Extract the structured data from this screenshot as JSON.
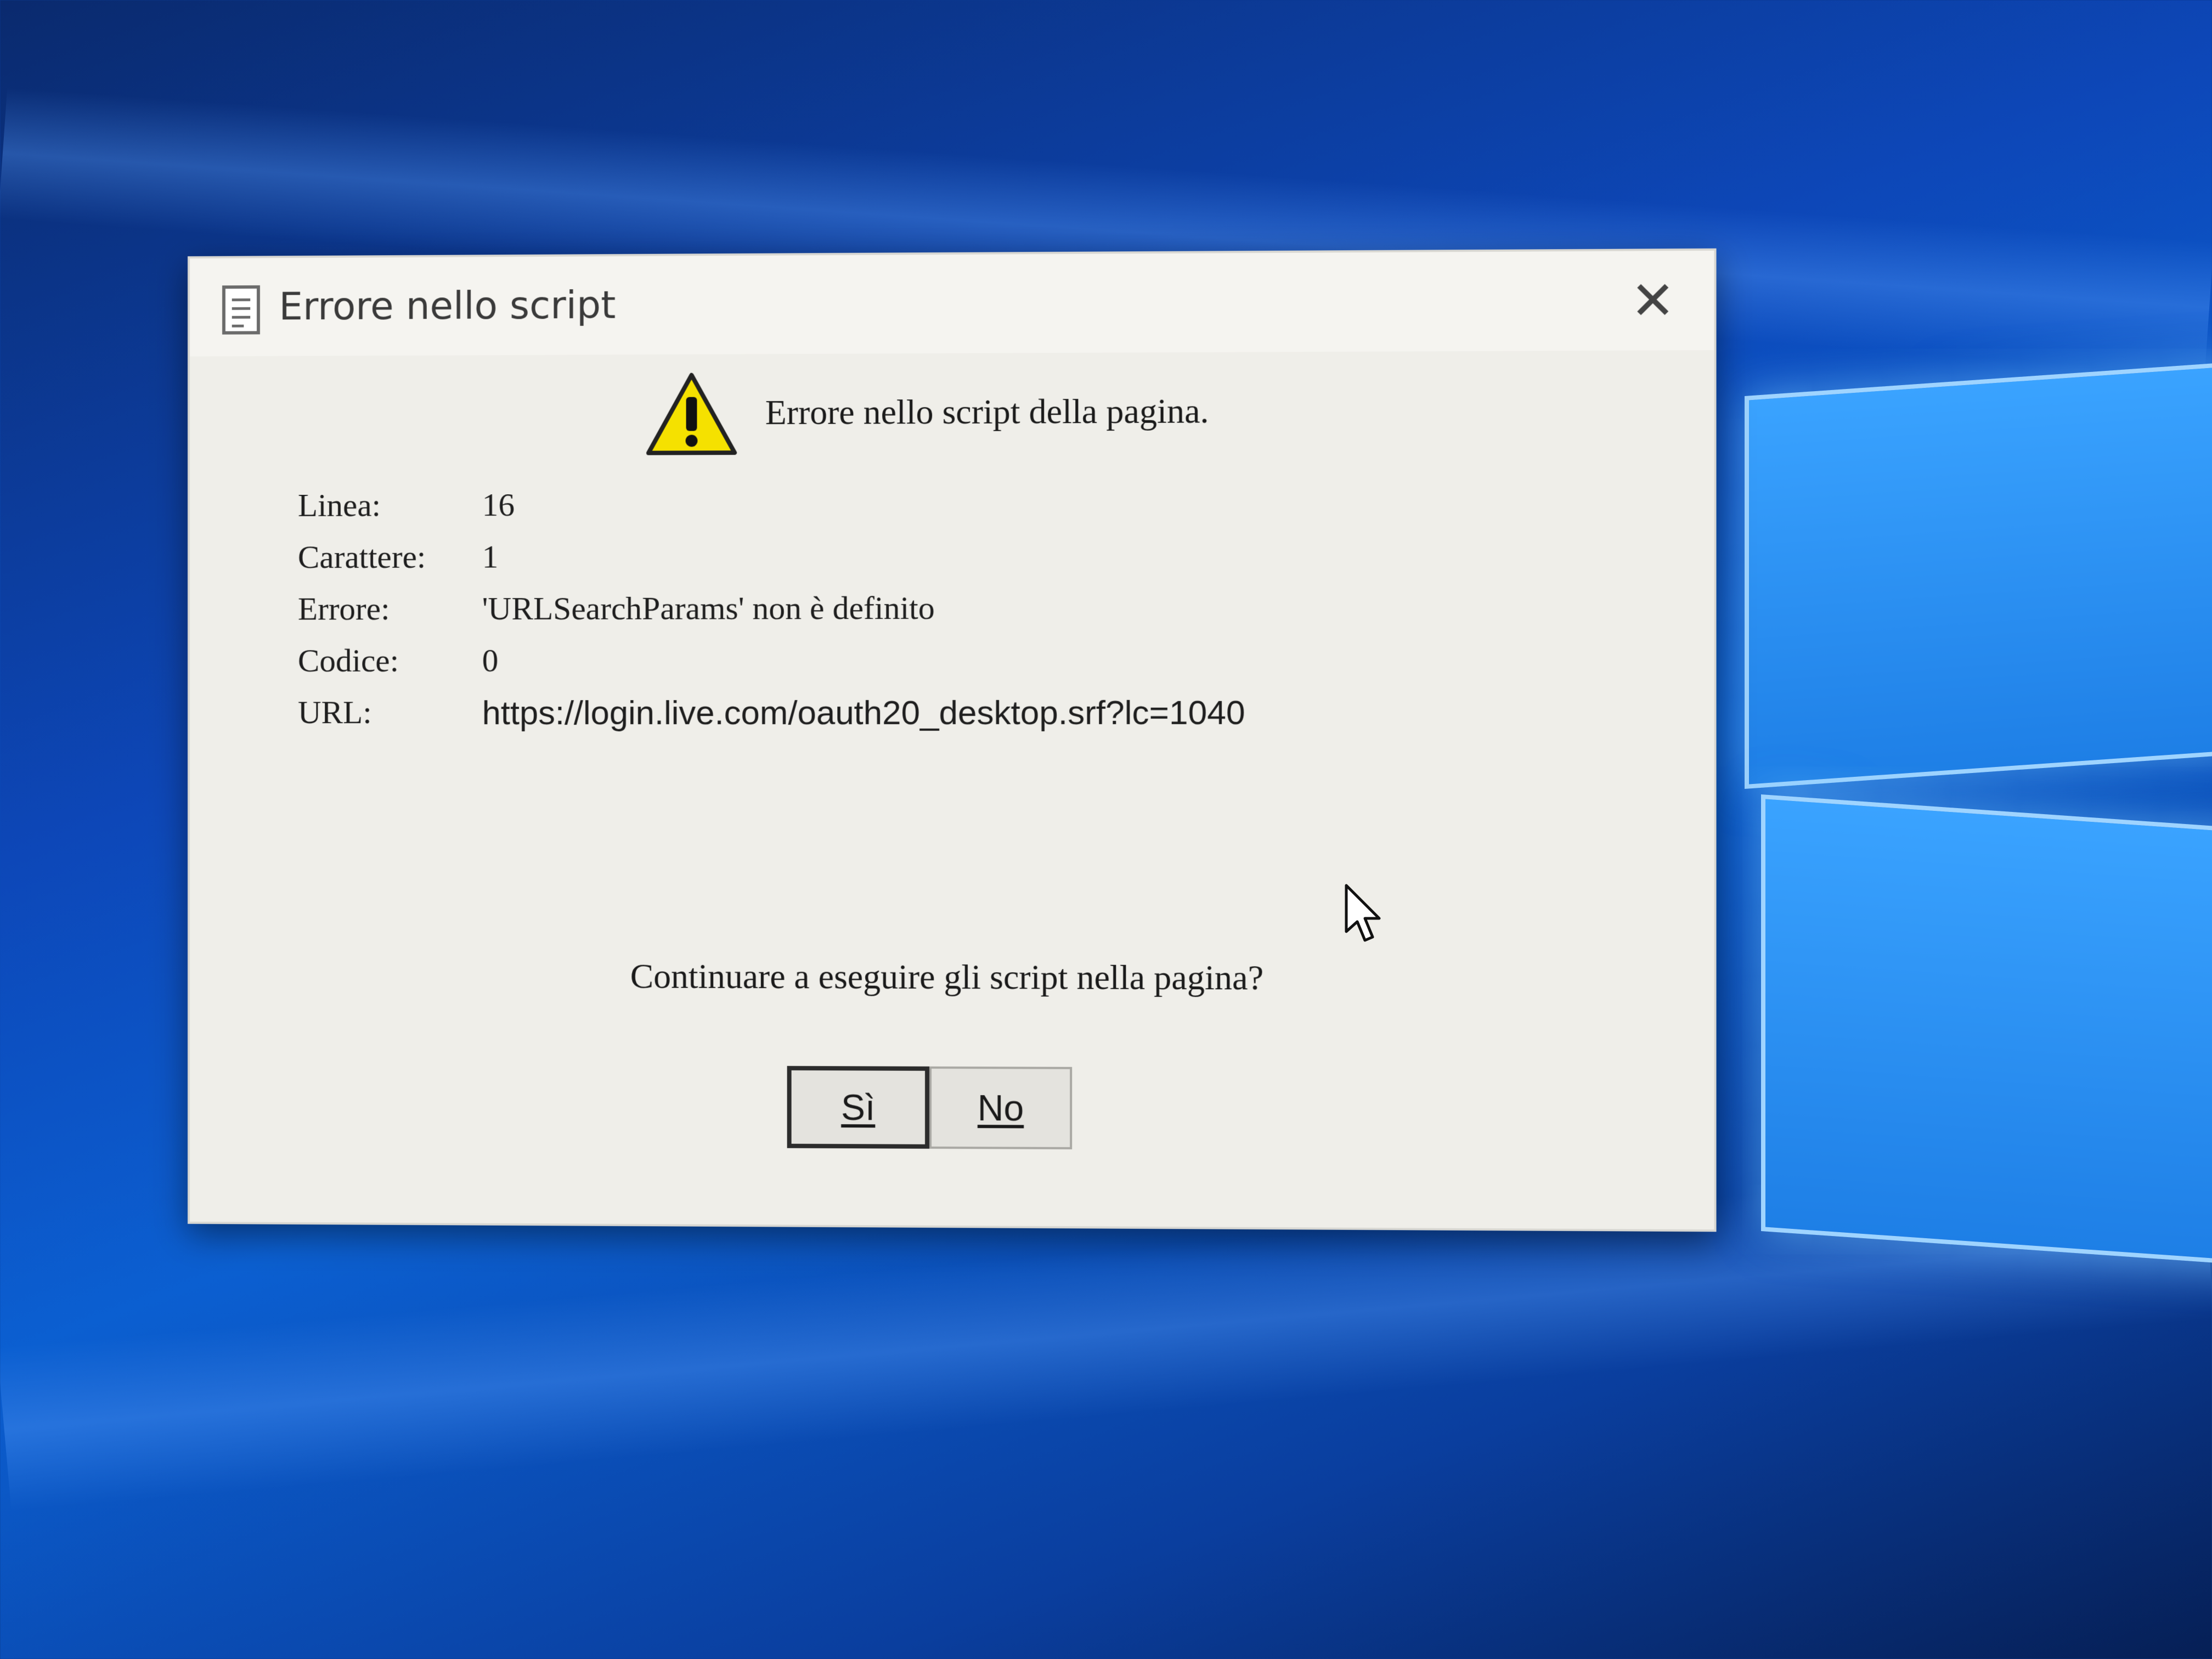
{
  "dialog": {
    "title": "Errore nello script",
    "close_label": "✕",
    "header_message": "Errore nello script della pagina.",
    "details": [
      {
        "label": "Linea:",
        "value": "16"
      },
      {
        "label": "Carattere:",
        "value": "1"
      },
      {
        "label": "Errore:",
        "value": "'URLSearchParams' non è definito"
      },
      {
        "label": "Codice:",
        "value": "0"
      },
      {
        "label": "URL:",
        "value": "https://login.live.com/oauth20_desktop.srf?lc=1040"
      }
    ],
    "question": "Continuare a eseguire gli script nella pagina?",
    "buttons": {
      "yes_label": "Sì",
      "no_label": "No"
    }
  },
  "colors": {
    "desktop_blue": "#0b5fd1",
    "dialog_background": "#efeee9",
    "warning_yellow": "#f5e100"
  },
  "icons": {
    "title": "document-icon",
    "header": "warning-icon",
    "pointer": "mouse-cursor-icon"
  }
}
